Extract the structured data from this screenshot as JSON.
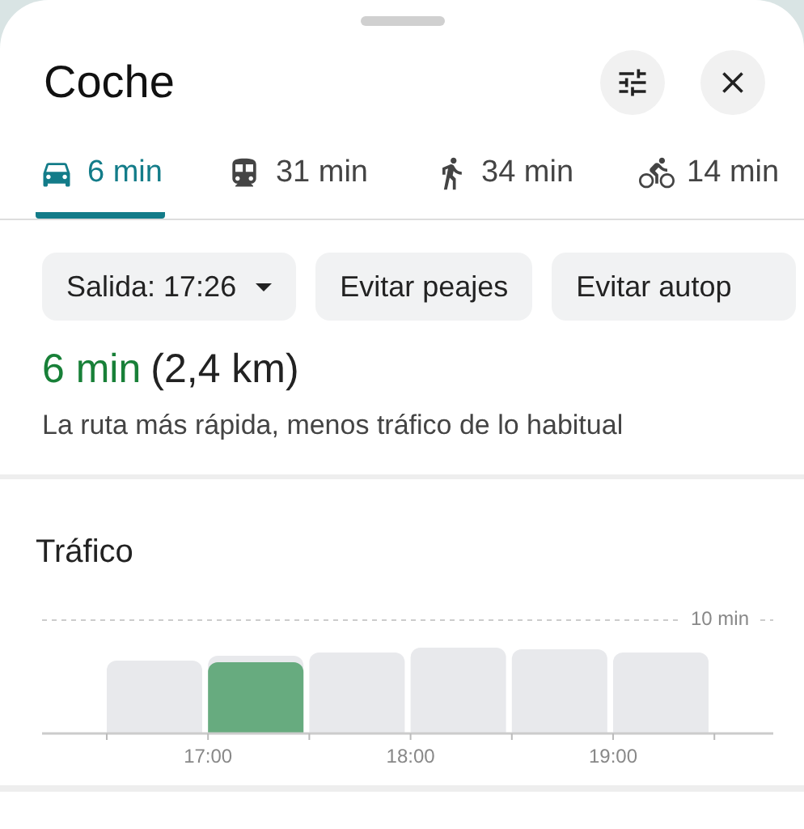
{
  "sheet": {
    "title": "Coche"
  },
  "tabs": [
    {
      "kind": "car",
      "label": "6 min",
      "selected": true
    },
    {
      "kind": "transit",
      "label": "31 min",
      "selected": false
    },
    {
      "kind": "walk",
      "label": "34 min",
      "selected": false
    },
    {
      "kind": "bike",
      "label": "14 min",
      "selected": false
    }
  ],
  "chips": [
    {
      "label": "Salida: 17:26",
      "dropdown": true
    },
    {
      "label": "Evitar peajes",
      "dropdown": false
    },
    {
      "label": "Evitar autop",
      "dropdown": false
    }
  ],
  "route": {
    "duration": "6 min",
    "distance": "(2,4 km)",
    "description": "La ruta más rápida, menos tráfico de lo habitual"
  },
  "traffic": {
    "title": "Tráfico",
    "reference_label": "10 min",
    "bars": [
      {
        "selected": false
      },
      {
        "selected": true
      },
      {
        "selected": false
      },
      {
        "selected": false
      },
      {
        "selected": false
      },
      {
        "selected": false
      }
    ],
    "time_labels": [
      "17:00",
      "18:00",
      "19:00"
    ]
  }
}
